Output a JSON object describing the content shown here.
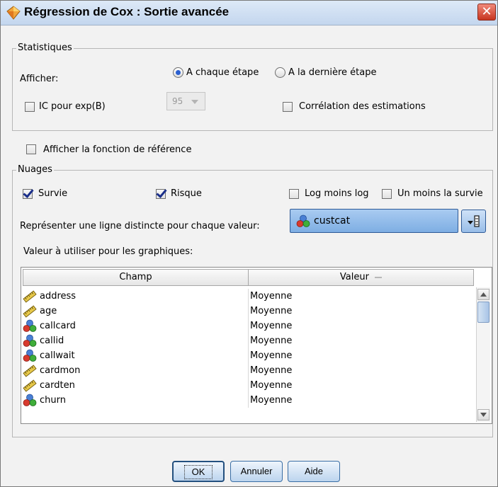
{
  "window": {
    "title": "Régression de Cox : Sortie avancée",
    "close_glyph": "✕"
  },
  "statistics": {
    "group_label": "Statistiques",
    "display_label": "Afficher:",
    "radio_each_step": "A chaque étape",
    "radio_last_step": "A la dernière étape",
    "radio_selected": "each_step",
    "ci_checkbox_label": "IC pour exp(B)",
    "ci_checked": false,
    "ci_value": "95",
    "corr_checkbox_label": "Corrélation des estimations",
    "corr_checked": false
  },
  "baseline": {
    "label": "Afficher la fonction de référence",
    "checked": false
  },
  "plots": {
    "group_label": "Nuages",
    "survival_label": "Survie",
    "survival_checked": true,
    "hazard_label": "Risque",
    "hazard_checked": true,
    "loglog_label": "Log moins log",
    "loglog_checked": false,
    "oneminus_label": "Un moins la survie",
    "oneminus_checked": false,
    "separate_line_label": "Représenter une ligne distincte pour chaque valeur:",
    "separate_line_value": "custcat",
    "values_label": "Valeur à utiliser pour les graphiques:"
  },
  "table": {
    "columns": [
      "Champ",
      "Valeur"
    ],
    "rows": [
      {
        "field": "address",
        "value": "Moyenne",
        "icon": "ruler-icon"
      },
      {
        "field": "age",
        "value": "Moyenne",
        "icon": "ruler-icon"
      },
      {
        "field": "callcard",
        "value": "Moyenne",
        "icon": "nominal-icon"
      },
      {
        "field": "callid",
        "value": "Moyenne",
        "icon": "nominal-icon"
      },
      {
        "field": "callwait",
        "value": "Moyenne",
        "icon": "nominal-icon"
      },
      {
        "field": "cardmon",
        "value": "Moyenne",
        "icon": "ruler-icon"
      },
      {
        "field": "cardten",
        "value": "Moyenne",
        "icon": "ruler-icon"
      },
      {
        "field": "churn",
        "value": "Moyenne",
        "icon": "nominal-icon"
      }
    ]
  },
  "buttons": {
    "ok": "OK",
    "cancel": "Annuler",
    "help": "Aide"
  },
  "colors": {
    "accent": "#2a5fd0",
    "title_bar": "#c3d6ee",
    "close": "#c8341f",
    "check": "#1b2f8a"
  }
}
